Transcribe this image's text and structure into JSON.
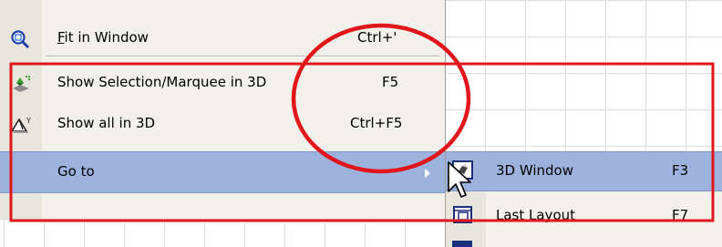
{
  "menu": {
    "items": [
      {
        "label": "Fit in Window",
        "accel": "F",
        "label_rest": "it in Window",
        "shortcut": "Ctrl+'",
        "icon": "zoom-fit-icon"
      },
      {
        "label": "Show Selection/Marquee in 3D",
        "shortcut": "F5",
        "icon": "selection-3d-icon"
      },
      {
        "label": "Show all in 3D",
        "shortcut": "Ctrl+F5",
        "icon": "show-all-3d-icon"
      },
      {
        "label": "Go to",
        "shortcut": "",
        "icon": ""
      }
    ]
  },
  "submenu": {
    "items": [
      {
        "label": "3D Window",
        "shortcut": "F3",
        "icon": "3d-window-icon"
      },
      {
        "label": "Last Layout",
        "shortcut": "F7",
        "icon": "layout-icon"
      }
    ]
  },
  "colors": {
    "menu_bg": "#f1f0ea",
    "highlight": "#9db3dd",
    "annotation": "#e0161b"
  }
}
